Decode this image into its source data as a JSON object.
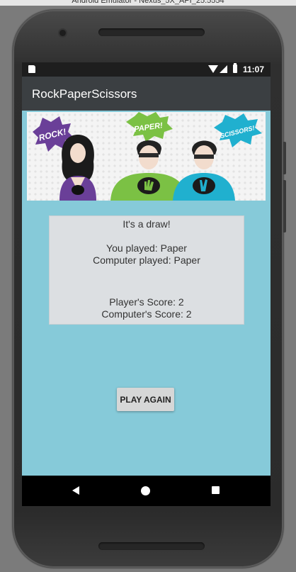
{
  "window": {
    "title": "Android Emulator - Nexus_5X_API_25:5554"
  },
  "status_bar": {
    "time": "11:07",
    "icons": [
      "sd-card-icon",
      "wifi-icon",
      "cell-signal-icon",
      "battery-charging-icon"
    ]
  },
  "app": {
    "title": "RockPaperScissors"
  },
  "banner": {
    "bubbles": {
      "rock": "ROCK!",
      "paper": "PAPER!",
      "scissors": "SCISSORS!"
    },
    "colors": {
      "rock": "#6a3f98",
      "paper": "#7bc144",
      "scissors": "#20b0cf"
    }
  },
  "result": {
    "outcome": "It's a draw!",
    "you_played": "You played: Paper",
    "computer_played": "Computer played: Paper",
    "player_score": "Player's Score: 2",
    "computer_score": "Computer's Score: 2"
  },
  "actions": {
    "play_again": "PLAY AGAIN"
  },
  "colors": {
    "background": "#86cad9",
    "app_bar": "#3b3f42",
    "result_box": "#dcdfe2",
    "button": "#d6d7d7"
  }
}
